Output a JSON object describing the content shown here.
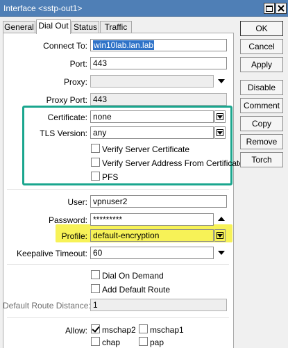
{
  "window": {
    "title": "Interface <sstp-out1>"
  },
  "tabs": [
    {
      "label": "General",
      "active": false
    },
    {
      "label": "Dial Out",
      "active": true
    },
    {
      "label": "Status",
      "active": false
    },
    {
      "label": "Traffic",
      "active": false
    }
  ],
  "form": {
    "connect_to": {
      "label": "Connect To:",
      "value": "win10lab.lan.lab"
    },
    "port": {
      "label": "Port:",
      "value": "443"
    },
    "proxy": {
      "label": "Proxy:",
      "value": ""
    },
    "proxy_port": {
      "label": "Proxy Port:",
      "value": "443"
    },
    "certificate": {
      "label": "Certificate:",
      "value": "none"
    },
    "tls_version": {
      "label": "TLS Version:",
      "value": "any"
    },
    "verify_server_certificate": {
      "label": "Verify Server Certificate",
      "checked": false
    },
    "verify_server_address": {
      "label": "Verify Server Address From Certificate",
      "checked": false
    },
    "pfs": {
      "label": "PFS",
      "checked": false
    },
    "user": {
      "label": "User:",
      "value": "vpnuser2"
    },
    "password": {
      "label": "Password:",
      "value": "*********"
    },
    "profile": {
      "label": "Profile:",
      "value": "default-encryption"
    },
    "keepalive_timeout": {
      "label": "Keepalive Timeout:",
      "value": "60"
    },
    "dial_on_demand": {
      "label": "Dial On Demand",
      "checked": false
    },
    "add_default_route": {
      "label": "Add Default Route",
      "checked": false
    },
    "default_route_distance": {
      "label": "Default Route Distance:",
      "value": "1"
    },
    "allow": {
      "label": "Allow:",
      "mschap2": {
        "label": "mschap2",
        "checked": true
      },
      "mschap1": {
        "label": "mschap1",
        "checked": false
      },
      "chap": {
        "label": "chap",
        "checked": false
      },
      "pap": {
        "label": "pap",
        "checked": false
      }
    }
  },
  "buttons": {
    "ok": "OK",
    "cancel": "Cancel",
    "apply": "Apply",
    "disable": "Disable",
    "comment": "Comment",
    "copy": "Copy",
    "remove": "Remove",
    "torch": "Torch"
  },
  "highlight_colors": {
    "tls_box": "#1aa68e",
    "profile": "#f7f257"
  }
}
